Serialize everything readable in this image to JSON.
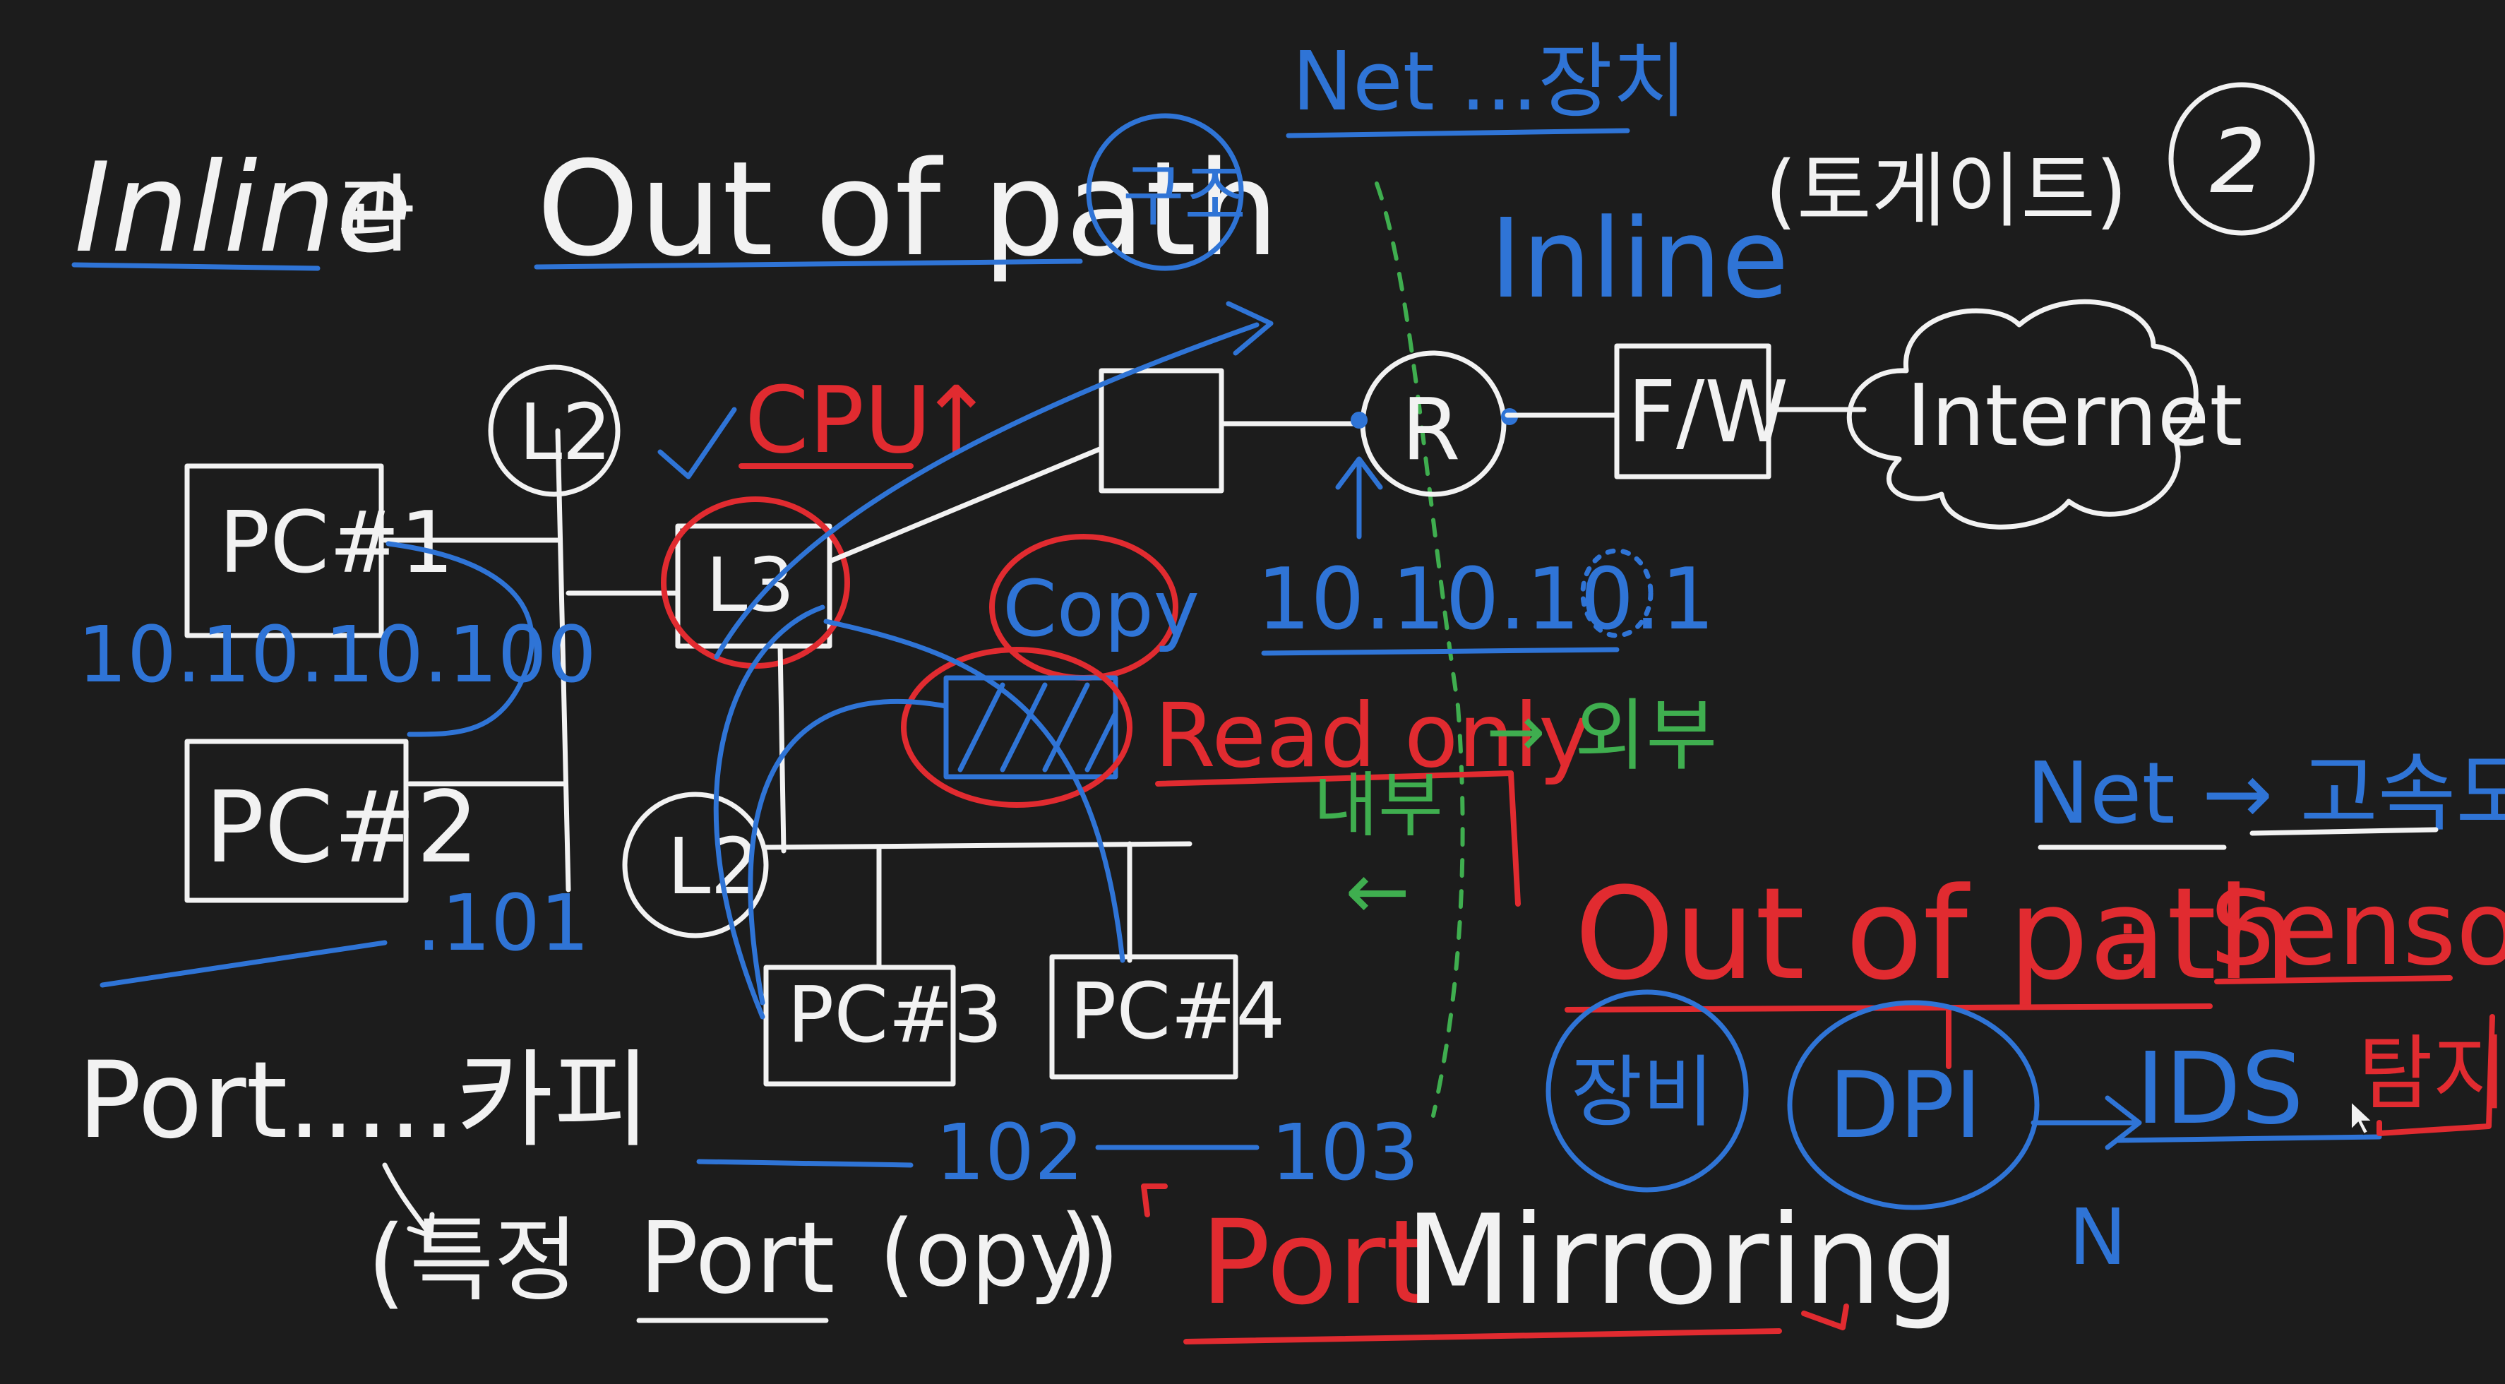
{
  "title": {
    "main_prefix": "Inline",
    "main_suffix": "과",
    "main_rest": "Out of path",
    "circled": "구조"
  },
  "header_blue": {
    "net_device": "Net ...장치"
  },
  "gateway": {
    "label": "(토게이트)",
    "circled": "2"
  },
  "inline_label": "Inline",
  "nodes": {
    "pc1": "PC#1",
    "pc2": "PC#2",
    "pc3": "PC#3",
    "pc4": "PC#4",
    "switch_top_l": "L2",
    "switch_bottom_l": "L2",
    "core_switch": "L3",
    "router": "R",
    "firewall": "F/W",
    "internet": "Internet"
  },
  "annotations": {
    "cpu": "CPU",
    "cpu_arrow": "↑",
    "copy": "Copy",
    "read_only": "Read only",
    "outer": "외부",
    "inner": "내부",
    "gw_ip": "10.10.10.1",
    "pc1_ip": "10.10.10.100",
    "pc2_ip": ".101",
    "pc3_ip": "102",
    "pc4_ip": "103",
    "net_high": "Net → 고속도로",
    "out_of_path": "Out of path",
    "sensor": "Sensor",
    "jangbi": "장비",
    "dpi": "DPI",
    "ids": "IDS",
    "tamji": "탐지",
    "n_label": "N",
    "port_copy": "Port.....카피",
    "specific": "특정",
    "port_word": "Port",
    "copy_paren": "(opy)",
    "port_mirroring_red": "Port",
    "port_mirroring_white": "Mirroring"
  },
  "colors": {
    "background": "#1c1c1c",
    "chalk_white": "#f2f2f2",
    "blue": "#2f74d6",
    "red": "#e12b30",
    "green": "#3fae4f"
  }
}
